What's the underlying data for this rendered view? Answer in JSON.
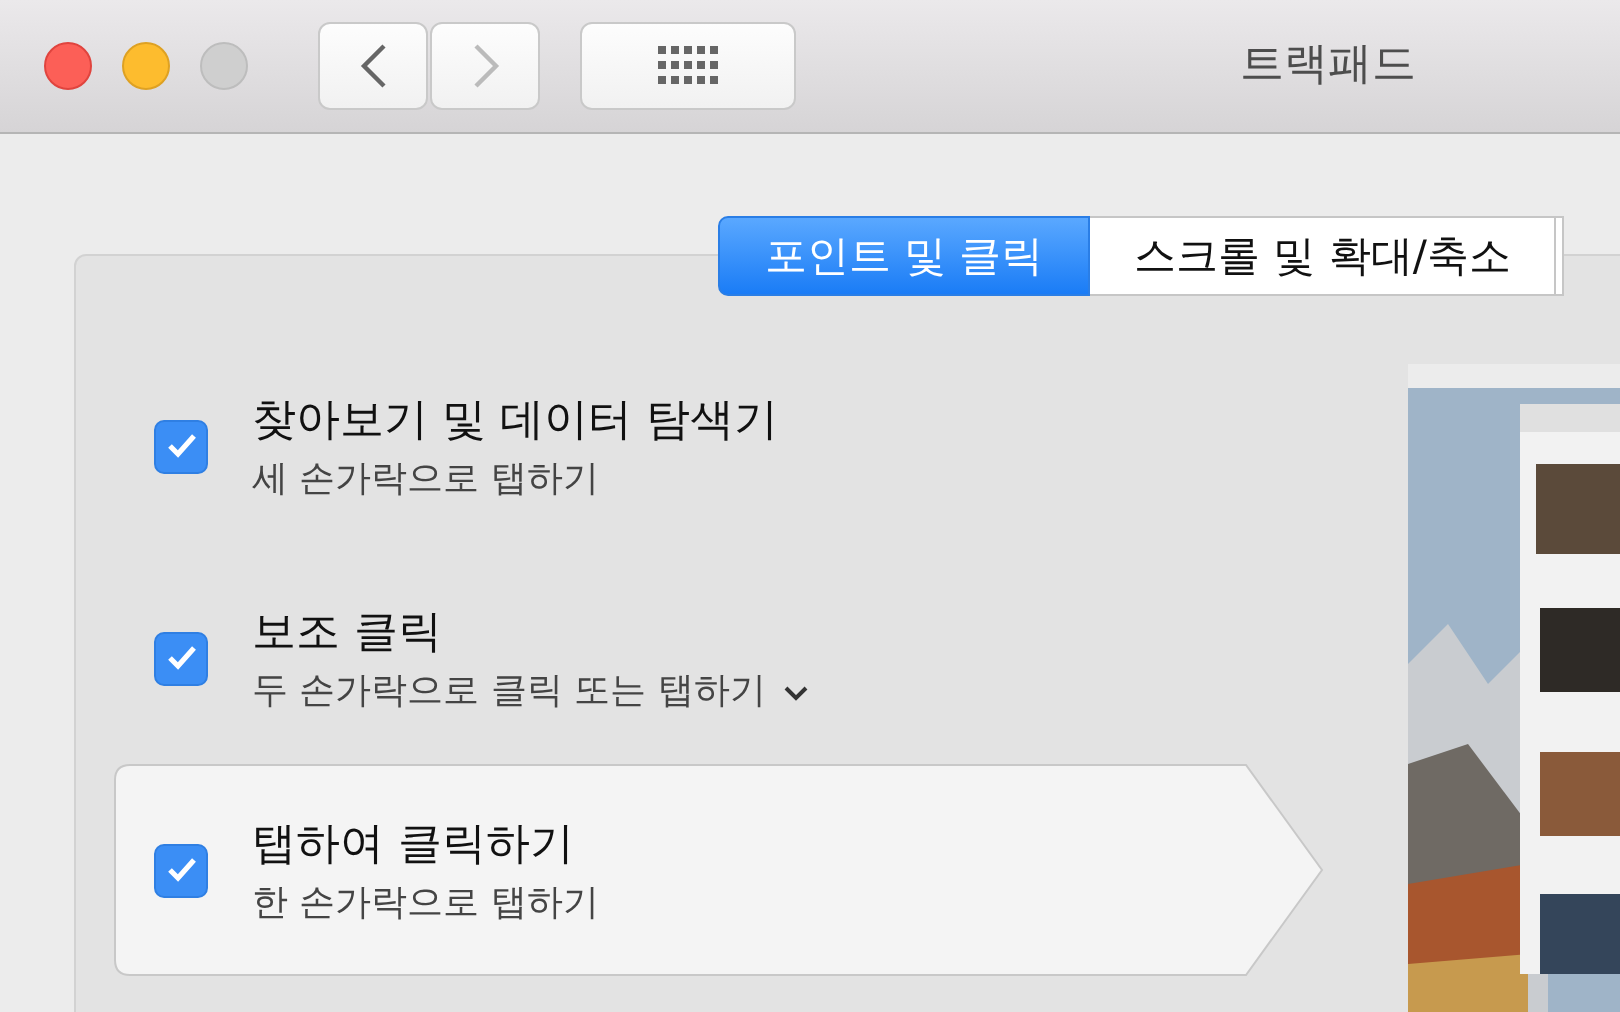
{
  "window": {
    "title": "트랙패드"
  },
  "tabs": [
    {
      "label": "포인트 및 클릭",
      "selected": true
    },
    {
      "label": "스크롤 및 확대/축소",
      "selected": false
    }
  ],
  "options": [
    {
      "title": "찾아보기 및 데이터 탐색기",
      "subtitle": "세 손가락으로 탭하기",
      "checked": true,
      "selected": false,
      "kind": "plain"
    },
    {
      "title": "보조 클릭",
      "subtitle": "두 손가락으로 클릭 또는 탭하기",
      "checked": true,
      "selected": false,
      "kind": "menu"
    },
    {
      "title": "탭하여 클릭하기",
      "subtitle": "한 손가락으로 탭하기",
      "checked": true,
      "selected": true,
      "kind": "plain"
    }
  ]
}
